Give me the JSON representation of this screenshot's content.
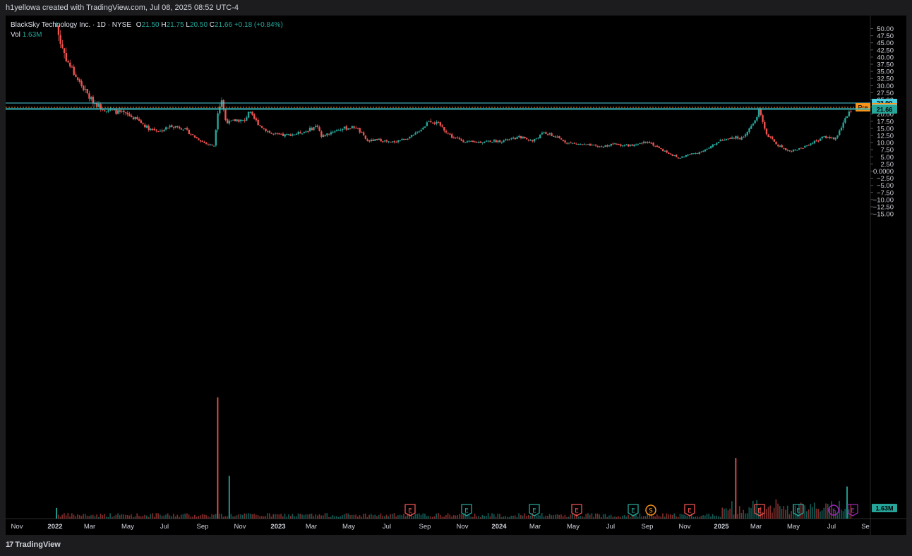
{
  "header": {
    "text": "h1yellowa created with TradingView.com, Jul 08, 2025 08:52 UTC-4"
  },
  "legend": {
    "title": "BlackSky Technology Inc. · 1D · NYSE",
    "o_label": "O",
    "o": "21.50",
    "h_label": "H",
    "h": "21.75",
    "l_label": "L",
    "l": "20.50",
    "c_label": "C",
    "c": "21.66",
    "change": "+0.18 (+0.84%)",
    "vol_label": "Vol",
    "vol": "1.63M"
  },
  "footer": {
    "brand": "TradingView",
    "logo": "17"
  },
  "colors": {
    "up": "#26a69a",
    "down": "#ef5350",
    "grid": "#1a1a1a",
    "level": "#4dd0e1",
    "pre": "#f7931a"
  },
  "chart_data": {
    "type": "candlestick",
    "x_ticks": [
      "Nov",
      "2022",
      "Mar",
      "May",
      "Jul",
      "Sep",
      "Nov",
      "2023",
      "Mar",
      "May",
      "Jul",
      "Sep",
      "Nov",
      "2024",
      "Mar",
      "May",
      "Jul",
      "Sep",
      "Nov",
      "2025",
      "Mar",
      "May",
      "Jul",
      "Se"
    ],
    "y_ticks": [
      "50.00",
      "47.50",
      "45.00",
      "42.50",
      "40.00",
      "37.50",
      "35.00",
      "32.50",
      "30.00",
      "27.50",
      "25.00",
      "22.50",
      "20.00",
      "17.50",
      "15.00",
      "12.50",
      "10.00",
      "7.50",
      "5.00",
      "2.50",
      "0.0000",
      "−2.50",
      "−5.00",
      "−7.50",
      "−10.00",
      "−12.50",
      "−15.00"
    ],
    "ylim": [
      -17.5,
      51
    ],
    "price_path": [
      [
        0,
        null
      ],
      [
        10,
        null
      ],
      [
        12,
        51
      ],
      [
        13,
        45
      ],
      [
        15,
        38
      ],
      [
        18,
        31
      ],
      [
        21,
        25
      ],
      [
        24,
        22
      ],
      [
        27,
        21
      ],
      [
        30,
        20
      ],
      [
        33,
        18
      ],
      [
        36,
        15
      ],
      [
        39,
        14
      ],
      [
        42,
        16
      ],
      [
        45,
        15
      ],
      [
        48,
        12
      ],
      [
        51,
        9.5
      ],
      [
        53,
        9
      ],
      [
        54,
        21
      ],
      [
        55,
        25
      ],
      [
        56,
        18
      ],
      [
        57,
        17
      ],
      [
        59,
        18
      ],
      [
        61,
        17.5
      ],
      [
        62,
        21
      ],
      [
        63,
        19
      ],
      [
        65,
        16
      ],
      [
        68,
        13
      ],
      [
        71,
        12.5
      ],
      [
        74,
        13
      ],
      [
        77,
        14
      ],
      [
        80,
        16
      ],
      [
        81,
        12
      ],
      [
        84,
        14
      ],
      [
        87,
        15
      ],
      [
        90,
        15.5
      ],
      [
        93,
        10.5
      ],
      [
        96,
        11
      ],
      [
        99,
        10
      ],
      [
        102,
        11
      ],
      [
        105,
        12.5
      ],
      [
        108,
        16
      ],
      [
        109,
        18
      ],
      [
        112,
        16
      ],
      [
        115,
        12
      ],
      [
        118,
        10.5
      ],
      [
        121,
        10
      ],
      [
        124,
        10.5
      ],
      [
        127,
        10.5
      ],
      [
        130,
        11
      ],
      [
        133,
        12
      ],
      [
        136,
        10.5
      ],
      [
        139,
        13.5
      ],
      [
        142,
        12
      ],
      [
        145,
        10
      ],
      [
        148,
        9.5
      ],
      [
        151,
        9
      ],
      [
        154,
        8.5
      ],
      [
        157,
        9.5
      ],
      [
        160,
        9
      ],
      [
        163,
        9
      ],
      [
        166,
        10.5
      ],
      [
        169,
        8
      ],
      [
        172,
        6
      ],
      [
        174,
        4.5
      ],
      [
        176,
        5.5
      ],
      [
        179,
        6.5
      ],
      [
        182,
        8
      ],
      [
        185,
        11
      ],
      [
        188,
        12
      ],
      [
        191,
        11.5
      ],
      [
        194,
        18
      ],
      [
        195,
        21
      ],
      [
        197,
        13
      ],
      [
        200,
        9
      ],
      [
        203,
        7
      ],
      [
        206,
        8
      ],
      [
        209,
        10
      ],
      [
        212,
        12
      ],
      [
        215,
        11.5
      ],
      [
        217,
        17
      ],
      [
        219,
        21.5
      ]
    ],
    "volume_spikes": [
      [
        12,
        1.5
      ],
      [
        54,
        17
      ],
      [
        57,
        6
      ],
      [
        189,
        8.5
      ],
      [
        218,
        4.5
      ]
    ],
    "volume": {
      "label": "Vol",
      "last": "1.63M"
    },
    "levels": [
      {
        "value": 23.9,
        "label": "23.90",
        "color": "#4dd0e1"
      },
      {
        "value": 22.39,
        "label": "22.39",
        "prefix": "Pre",
        "color": "#f7931a"
      },
      {
        "value": 21.92,
        "label": "21.92",
        "color": "#4dd0e1"
      },
      {
        "value": 21.66,
        "label": "21.66",
        "color": "#26a69a"
      }
    ],
    "events": [
      {
        "i": 0,
        "label": "E",
        "kind": "earnings-miss"
      },
      {
        "i": 1,
        "label": "E",
        "kind": "earnings-beat"
      },
      {
        "i": 2,
        "label": "E",
        "kind": "earnings-beat"
      },
      {
        "i": 3,
        "label": "E",
        "kind": "earnings-miss"
      },
      {
        "i": 4,
        "label": "E",
        "kind": "earnings-beat"
      },
      {
        "i": 5,
        "label": "S",
        "kind": "split"
      },
      {
        "i": 6,
        "label": "E",
        "kind": "earnings-miss"
      },
      {
        "i": 7,
        "label": "E",
        "kind": "earnings-miss"
      },
      {
        "i": 8,
        "label": "E",
        "kind": "earnings-beat"
      },
      {
        "i": 9,
        "label": "⚡",
        "kind": "news"
      },
      {
        "i": 10,
        "label": "E",
        "kind": "earnings-upcoming"
      }
    ]
  }
}
